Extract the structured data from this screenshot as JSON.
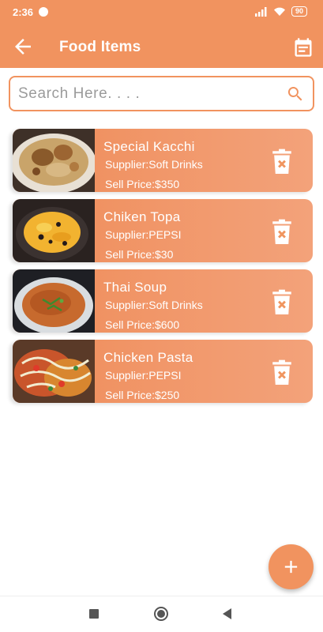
{
  "status": {
    "time": "2:36",
    "battery": "90"
  },
  "toolbar": {
    "title": "Food Items"
  },
  "search": {
    "placeholder": "Search Here. . . ."
  },
  "items": [
    {
      "name": "Special Kacchi",
      "supplier": "Supplier:Soft Drinks",
      "price": "Sell Price:$350"
    },
    {
      "name": "Chiken Topa",
      "supplier": "Supplier:PEPSI",
      "price": "Sell Price:$30"
    },
    {
      "name": "Thai Soup",
      "supplier": "Supplier:Soft Drinks",
      "price": "Sell Price:$600"
    },
    {
      "name": "Chicken Pasta",
      "supplier": "Supplier:PEPSI",
      "price": "Sell Price:$250"
    }
  ],
  "colors": {
    "primary": "#f1935f",
    "card_start": "#ef8c59",
    "card_end": "#f3a27a"
  },
  "icons": {
    "back": "arrow-left-icon",
    "calendar": "calendar-icon",
    "search": "search-icon",
    "delete": "trash-x-icon",
    "add": "plus-icon"
  }
}
